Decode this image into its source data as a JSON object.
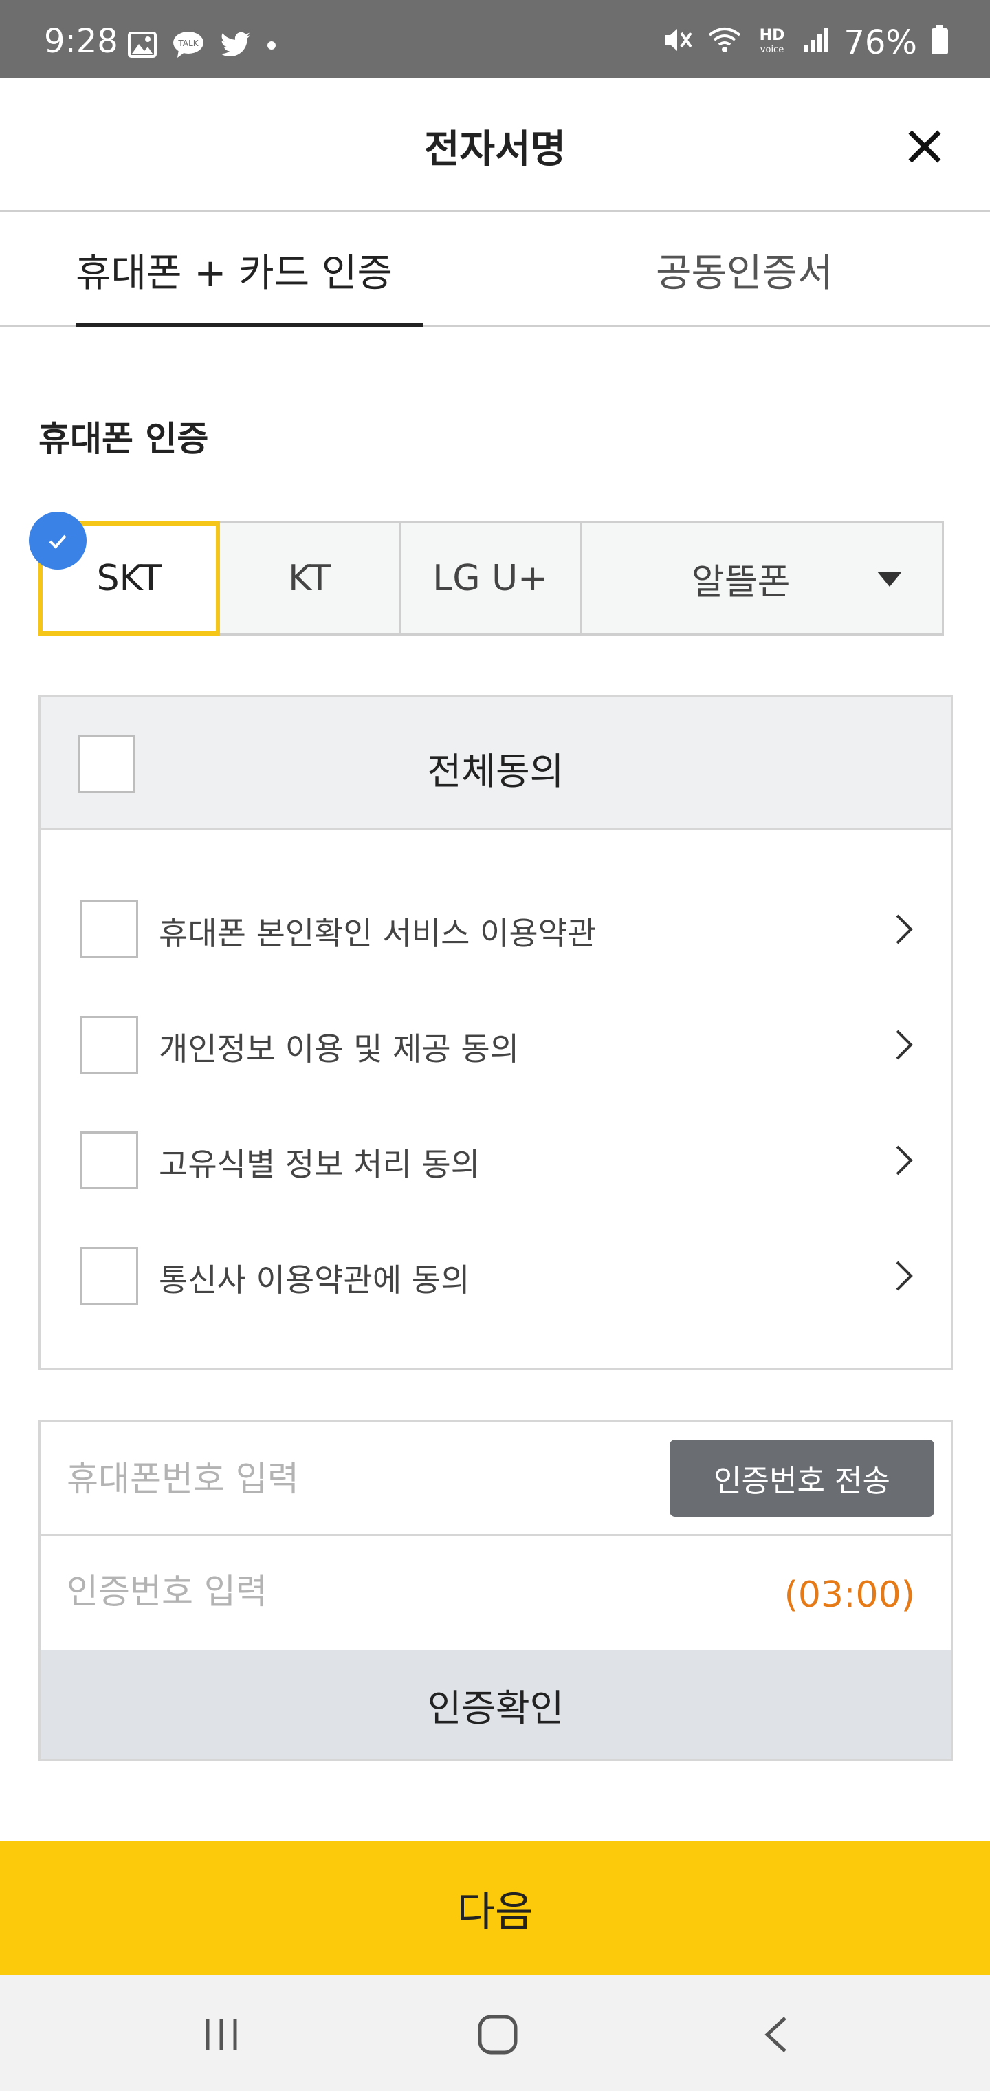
{
  "status_bar": {
    "time": "9:28",
    "battery": "76%",
    "left_icons": [
      "gallery-icon",
      "talk-icon",
      "twitter-icon",
      "dot-icon"
    ],
    "right_icons": [
      "mute-icon",
      "wifi-icon",
      "hd-voice-icon",
      "signal-icon",
      "battery-icon"
    ],
    "talk_badge": "TALK",
    "hd_label": "HD",
    "voice_label": "voice"
  },
  "header": {
    "title": "전자서명",
    "close_icon": "close-icon"
  },
  "tabs": [
    {
      "label": "휴대폰 + 카드 인증",
      "active": true
    },
    {
      "label": "공동인증서",
      "active": false
    }
  ],
  "section_title": "휴대폰 인증",
  "carriers": {
    "selected": "SKT",
    "items": [
      "SKT",
      "KT",
      "LG U+",
      "알뜰폰"
    ]
  },
  "agreements": {
    "all_label": "전체동의",
    "items": [
      "휴대폰 본인확인 서비스 이용약관",
      "개인정보 이용 및 제공 동의",
      "고유식별 정보 처리 동의",
      "통신사 이용약관에 동의"
    ]
  },
  "verification": {
    "phone_placeholder": "휴대폰번호 입력",
    "send_label": "인증번호 전송",
    "code_placeholder": "인증번호 입력",
    "timer": "(03:00)",
    "verify_label": "인증확인"
  },
  "next_label": "다음",
  "colors": {
    "accent_yellow": "#fcca0a",
    "selected_border": "#f5c518",
    "check_badge": "#3b82e6",
    "timer": "#e57a17",
    "send_button": "#6a6e73"
  }
}
